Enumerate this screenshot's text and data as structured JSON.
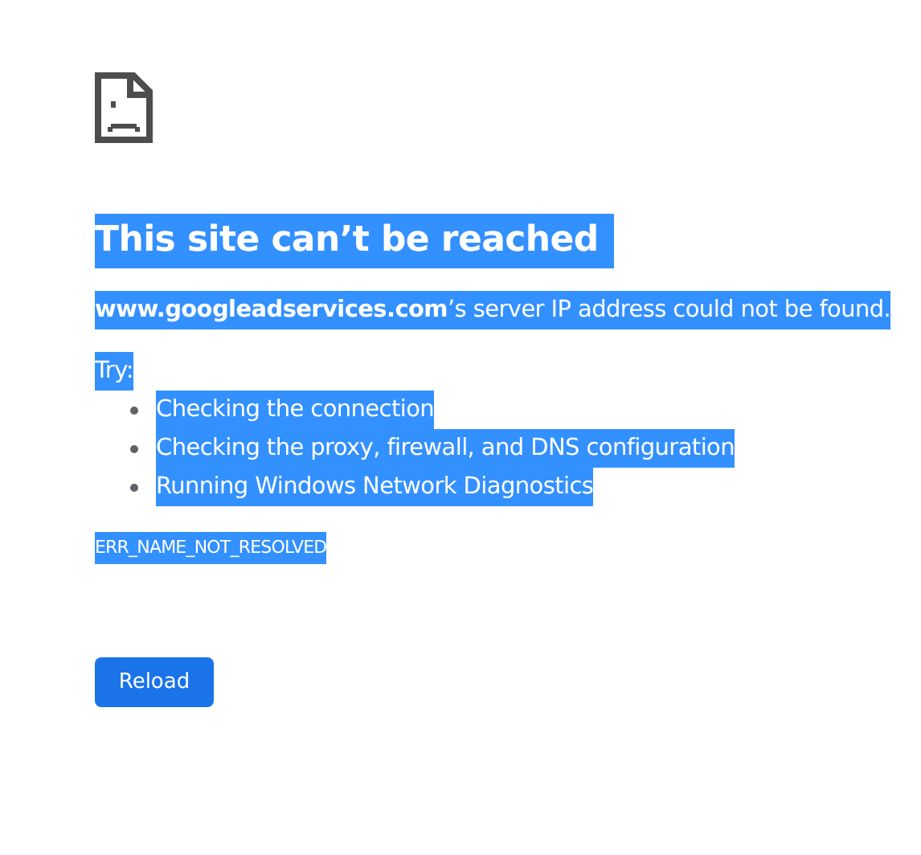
{
  "text_selected": true,
  "heading": "This site can’t be reached",
  "message": "**www.googleadservices.com**’s server IP address could not be found.",
  "try_label": "Try:",
  "suggestions": [
    "Checking the connection",
    "Checking the proxy, firewall, and DNS configuration",
    "Running Windows Network Diagnostics"
  ],
  "error_code": "ERR_NAME_NOT_RESOLVED",
  "button": "Reload"
}
